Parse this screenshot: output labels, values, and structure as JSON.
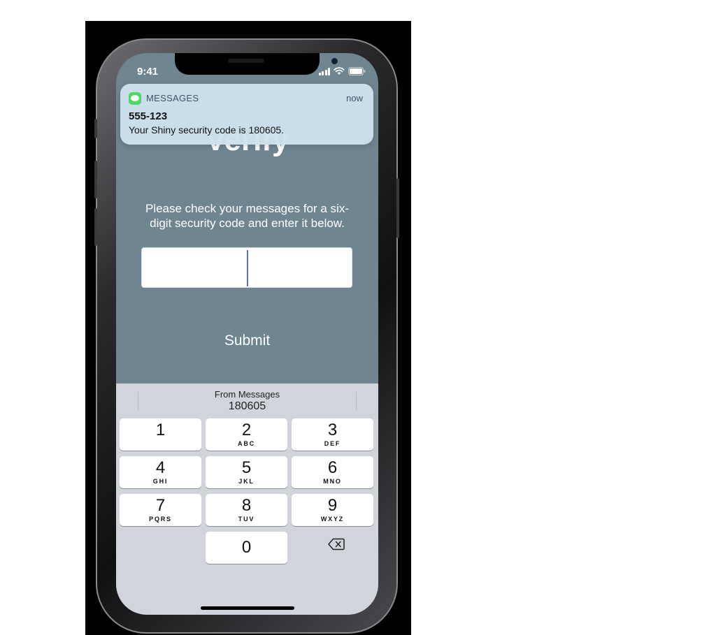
{
  "status_bar": {
    "time": "9:41"
  },
  "notification": {
    "app": "MESSAGES",
    "time": "now",
    "sender": "555-123",
    "body": "Your Shiny security code is 180605."
  },
  "page": {
    "title": "Verify",
    "instructions": "Please check your messages for a six-digit security code and enter it below.",
    "code_input_value": "",
    "submit_label": "Submit"
  },
  "keyboard": {
    "suggestion_source": "From Messages",
    "suggestion_code": "180605",
    "keys": [
      {
        "num": "1",
        "letters": ""
      },
      {
        "num": "2",
        "letters": "ABC"
      },
      {
        "num": "3",
        "letters": "DEF"
      },
      {
        "num": "4",
        "letters": "GHI"
      },
      {
        "num": "5",
        "letters": "JKL"
      },
      {
        "num": "6",
        "letters": "MNO"
      },
      {
        "num": "7",
        "letters": "PQRS"
      },
      {
        "num": "8",
        "letters": "TUV"
      },
      {
        "num": "9",
        "letters": "WXYZ"
      },
      {
        "num": "0",
        "letters": ""
      }
    ],
    "delete_icon": "delete-backspace-icon"
  },
  "colors": {
    "screen_background": "#6f8590",
    "keyboard_background": "#d1d5db",
    "notification_background": "#cee2ec",
    "messages_icon": "#4cd964",
    "caret": "#5a6ee0"
  }
}
